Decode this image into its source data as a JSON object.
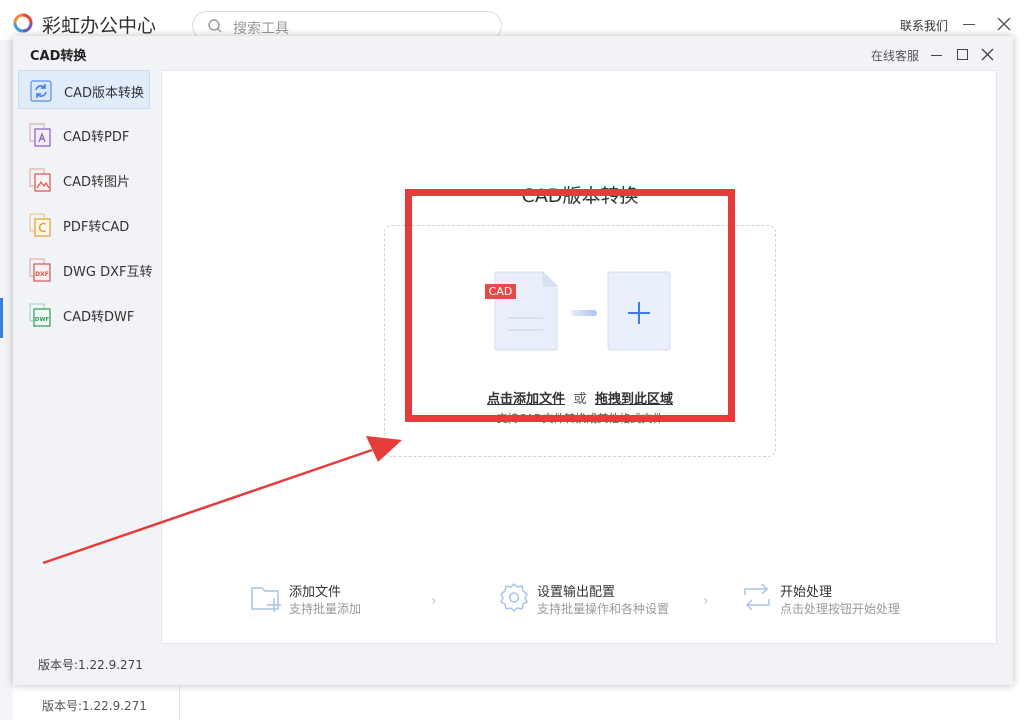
{
  "app": {
    "name": "彩虹办公中心",
    "search_placeholder": "搜索工具",
    "contact": "联系我们",
    "version": "版本号:1.22.9.271"
  },
  "dialog": {
    "title": "CAD转换",
    "service": "在线客服",
    "version": "版本号:1.22.9.271"
  },
  "sidebar": {
    "items": [
      {
        "label": "CAD版本转换",
        "icon": "cad-version-icon",
        "active": true
      },
      {
        "label": "CAD转PDF",
        "icon": "cad-to-pdf-icon"
      },
      {
        "label": "CAD转图片",
        "icon": "cad-to-image-icon"
      },
      {
        "label": "PDF转CAD",
        "icon": "pdf-to-cad-icon"
      },
      {
        "label": "DWG DXF互转",
        "icon": "dwg-dxf-icon"
      },
      {
        "label": "CAD转DWF",
        "icon": "cad-to-dwf-icon"
      }
    ]
  },
  "main": {
    "title": "CAD版本转换",
    "drop": {
      "badge": "CAD",
      "click_add": "点击添加文件",
      "or": "或",
      "drag": "拖拽到此区域",
      "hint": "支持CAD文件转换成其他格式文件"
    },
    "steps": [
      {
        "title": "添加文件",
        "desc": "支持批量添加"
      },
      {
        "title": "设置输出配置",
        "desc": "支持批量操作和各种设置"
      },
      {
        "title": "开始处理",
        "desc": "点击处理按钮开始处理"
      }
    ],
    "chevron": "›"
  },
  "colors": {
    "accent": "#3a7bf0",
    "annotation_red": "#e53b3b",
    "active_bg": "#e1ecfb"
  }
}
